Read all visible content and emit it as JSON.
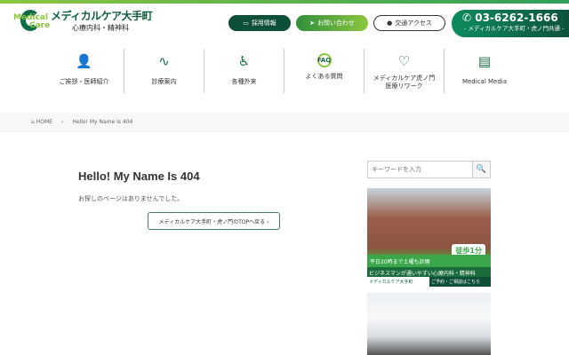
{
  "header": {
    "logo_mark": [
      "Medical",
      "Care"
    ],
    "clinic_name": "メディカルケア大手町",
    "clinic_sub": "心療内科・精神科",
    "buttons": {
      "recruit": "採用情報",
      "contact": "お問い合わせ",
      "access": "交通アクセス"
    },
    "phone": {
      "number": "03-6262-1666",
      "note": "- メディカルケア大手町・虎ノ門共通 -"
    }
  },
  "nav": [
    {
      "label": "ご挨拶・医師紹介",
      "icon": "doctor-icon"
    },
    {
      "label": "診療案内",
      "icon": "stethoscope-icon"
    },
    {
      "label": "各種外来",
      "icon": "patient-icon"
    },
    {
      "label": "よくある質問",
      "icon": "faq-icon"
    },
    {
      "label": "メディカルケア虎ノ門\n医療リワーク",
      "icon": "heart-icon"
    },
    {
      "label": "Medical Media",
      "icon": "document-icon"
    }
  ],
  "breadcrumb": {
    "home": "HOME",
    "current": "Hello! My Name Is 404"
  },
  "main": {
    "title": "Hello! My Name Is 404",
    "message": "お探しのページはありませんでした。",
    "back_button": "メディカルケア大手町・虎ノ門のTOPへ戻る ›"
  },
  "sidebar": {
    "search_placeholder": "キーワードを入力",
    "banner": {
      "tag": "平日20時まで土曜も診療",
      "walk": "徒歩1分",
      "tagline": "ビジネスマンが通いやすい心療内科・精神科",
      "logo": "メディカルケア大手町",
      "cta": "ご予約・ご相談はこちら"
    }
  }
}
